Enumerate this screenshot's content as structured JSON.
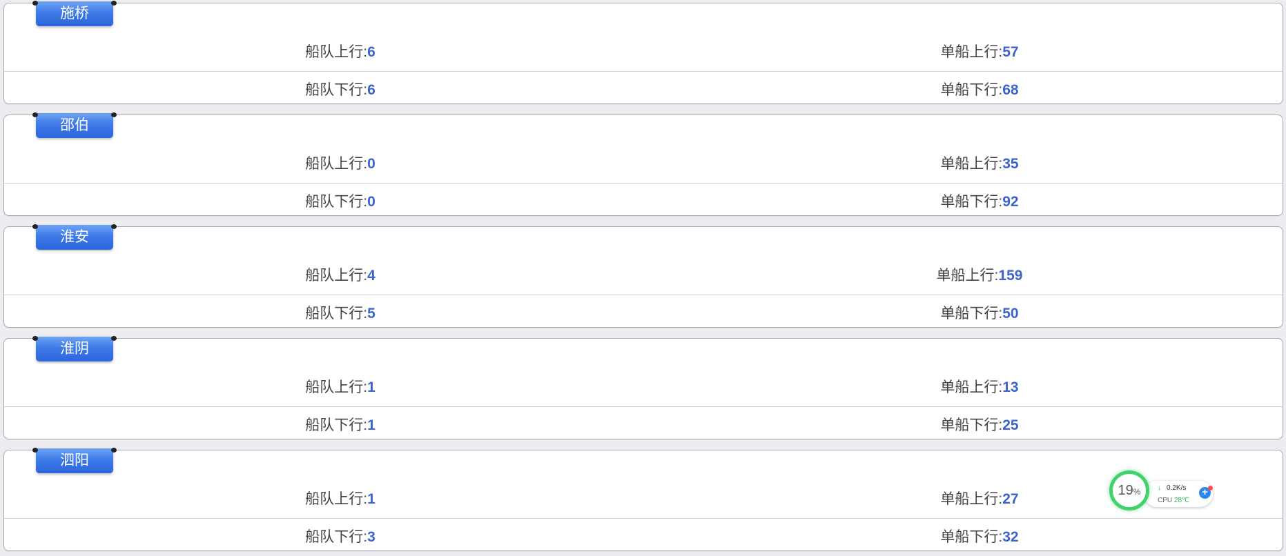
{
  "stations": [
    {
      "name": "施桥",
      "fleet_up_label": "船队上行:",
      "fleet_up": "6",
      "single_up_label": "单船上行:",
      "single_up": "57",
      "fleet_down_label": "船队下行:",
      "fleet_down": "6",
      "single_down_label": "单船下行:",
      "single_down": "68"
    },
    {
      "name": "邵伯",
      "fleet_up_label": "船队上行:",
      "fleet_up": "0",
      "single_up_label": "单船上行:",
      "single_up": "35",
      "fleet_down_label": "船队下行:",
      "fleet_down": "0",
      "single_down_label": "单船下行:",
      "single_down": "92"
    },
    {
      "name": "淮安",
      "fleet_up_label": "船队上行:",
      "fleet_up": "4",
      "single_up_label": "单船上行:",
      "single_up": "159",
      "fleet_down_label": "船队下行:",
      "fleet_down": "5",
      "single_down_label": "单船下行:",
      "single_down": "50"
    },
    {
      "name": "淮阴",
      "fleet_up_label": "船队上行:",
      "fleet_up": "1",
      "single_up_label": "单船上行:",
      "single_up": "13",
      "fleet_down_label": "船队下行:",
      "fleet_down": "1",
      "single_down_label": "单船下行:",
      "single_down": "25"
    },
    {
      "name": "泗阳",
      "fleet_up_label": "船队上行:",
      "fleet_up": "1",
      "single_up_label": "单船上行:",
      "single_up": "27",
      "fleet_down_label": "船队下行:",
      "fleet_down": "3",
      "single_down_label": "单船下行:",
      "single_down": "32"
    }
  ],
  "widget": {
    "cpu_percent_value": "19",
    "percent_sign": "%",
    "net_speed": "0.2K/s",
    "cpu_label": "CPU",
    "temperature": "28℃",
    "icons": [
      "download-arrow-icon",
      "plus-icon"
    ]
  },
  "colors": {
    "tab_blue": "#3e7ae8",
    "value_blue": "#3b63d0",
    "ring_green": "#41d26b"
  }
}
